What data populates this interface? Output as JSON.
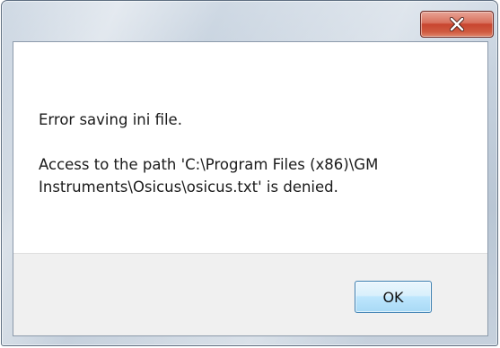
{
  "window": {
    "title": ""
  },
  "titlebar": {
    "close_icon": "close-x-icon"
  },
  "message": {
    "line1": "Error saving ini file.",
    "line2": "Access to the path 'C:\\Program Files (x86)\\GM Instruments\\Osicus\\osicus.txt' is denied."
  },
  "buttons": {
    "ok_label": "OK"
  },
  "colors": {
    "close_button": "#c8452f",
    "ok_button_border": "#3c7fb1",
    "footer_bg": "#f0f0f0"
  }
}
